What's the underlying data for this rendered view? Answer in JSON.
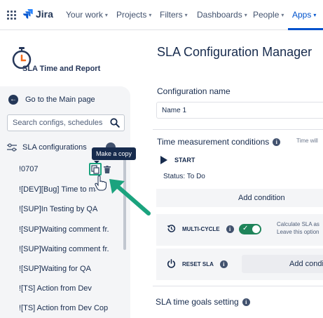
{
  "nav": {
    "product": "Jira",
    "items": [
      {
        "label": "Your work",
        "active": false
      },
      {
        "label": "Projects",
        "active": false
      },
      {
        "label": "Filters",
        "active": false
      },
      {
        "label": "Dashboards",
        "active": false
      },
      {
        "label": "People",
        "active": false
      },
      {
        "label": "Apps",
        "active": true
      }
    ],
    "accent": "#0052cc"
  },
  "sidebar": {
    "app_name": "SLA Time and Report",
    "back_link": "Go to the Main page",
    "search_placeholder": "Search configs, schedules",
    "section_label": "SLA configurations",
    "tooltip": "Make a copy",
    "configs": [
      "!0707",
      "![DEV][Bug] Time to mark",
      "![SUP]In Testing by QA",
      "![SUP]Waiting comment fr...",
      "![SUP]Waiting comment fr...",
      "![SUP]Waiting for QA",
      "![TS] Action from Dev",
      "![TS] Action from Dev Cop..."
    ],
    "highlight_color": "#1ba37e"
  },
  "main": {
    "title": "SLA Configuration Manager",
    "config_name_label": "Configuration name",
    "config_name_value": "Name 1",
    "time_conditions_label": "Time measurement conditions",
    "time_will_text": "Time will",
    "start_label": "START",
    "status_text": "Status: To Do",
    "add_condition_label": "Add condition",
    "multi_cycle_label": "MULTI-CYCLE",
    "multi_cycle_enabled": true,
    "multi_cycle_desc_line1": "Calculate SLA as",
    "multi_cycle_desc_line2": "Leave this option",
    "reset_label": "RESET SLA",
    "add_condition_label2": "Add condi",
    "goals_label": "SLA time goals setting"
  }
}
